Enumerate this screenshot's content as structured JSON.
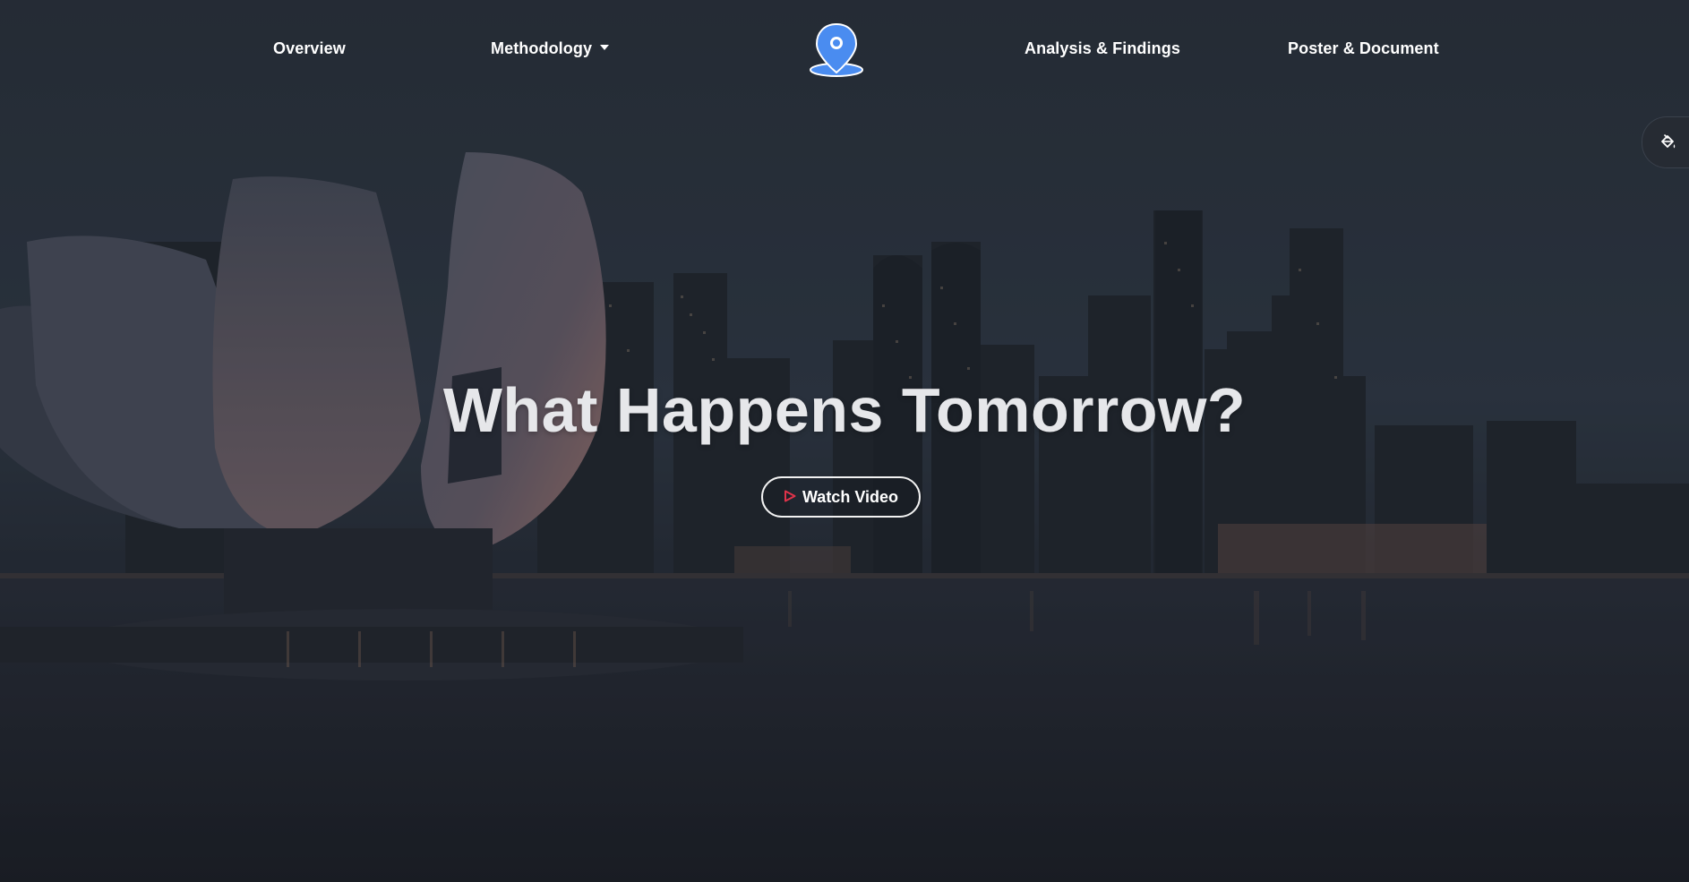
{
  "nav": {
    "overview": "Overview",
    "methodology": "Methodology",
    "analysis": "Analysis & Findings",
    "poster": "Poster & Document"
  },
  "logo": {
    "icon": "map-pin-icon",
    "color": "#4a8cf0"
  },
  "side_tab": {
    "icon": "paint-bucket-icon"
  },
  "hero": {
    "headline": "What Happens Tomorrow?",
    "button_label": "Watch Video",
    "button_icon": "play-icon",
    "play_color": "#e0334a"
  }
}
